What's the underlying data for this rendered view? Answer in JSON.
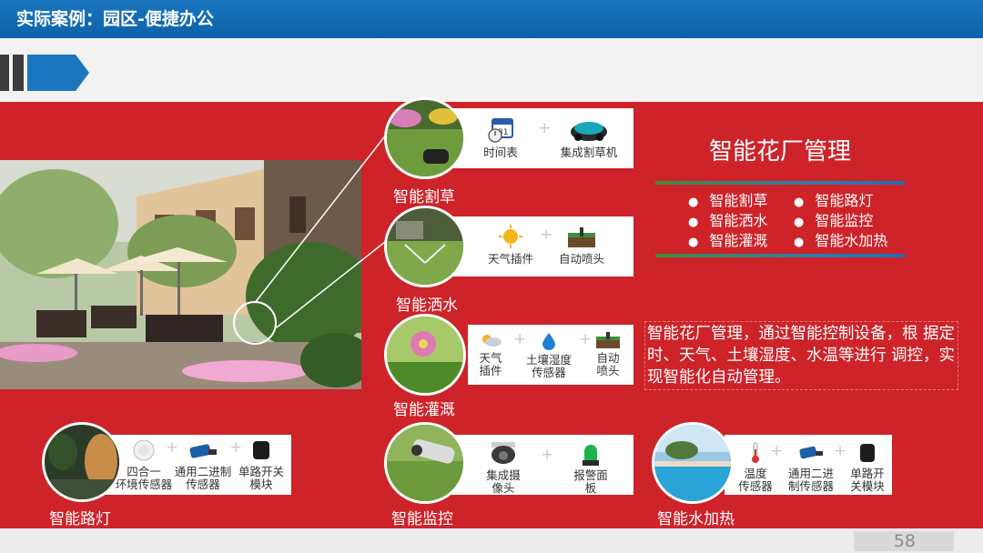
{
  "header": {
    "title": "实际案例：园区-便捷办公"
  },
  "page_number": "58",
  "main": {
    "heading": "智能花厂管理",
    "features": [
      {
        "label": "智能割草",
        "items": [
          "时间表",
          "集成割草机"
        ]
      },
      {
        "label": "智能洒水",
        "items": [
          "天气插件",
          "自动喷头"
        ]
      },
      {
        "label": "智能灌溉",
        "items": [
          "天气\n插件",
          "土壤湿度\n传感器",
          "自动\n喷头"
        ]
      },
      {
        "label": "智能路灯",
        "items": [
          "四合一\n环境传感器",
          "通用二进制\n传感器",
          "单路开关\n模块"
        ]
      },
      {
        "label": "智能监控",
        "items": [
          "集成摄\n像头",
          "报警面\n板"
        ]
      },
      {
        "label": "智能水加热",
        "items": [
          "温度\n传感器",
          "通用二进\n制传感器",
          "单路开\n关模块"
        ]
      }
    ],
    "bullets": [
      [
        "智能割草",
        "智能路灯"
      ],
      [
        "智能洒水",
        "智能监控"
      ],
      [
        "智能灌溉",
        "智能水加热"
      ]
    ],
    "description": "智能花厂管理，通过智能控制设备，根 据定时、天气、土壤湿度、水温等进行 调控，实现智能化自动管理。"
  },
  "icons": {
    "plus": "+",
    "names": [
      "calendar-clock-icon",
      "robot-mower-icon",
      "sun-icon",
      "sprinkler-icon",
      "weather-icon",
      "water-drop-icon",
      "sensor-icon",
      "usb-sensor-icon",
      "switch-module-icon",
      "camera-icon",
      "alarm-light-icon",
      "thermometer-icon"
    ]
  },
  "colors": {
    "header": "#1a76bf",
    "panel": "#cd2329",
    "accent_green": "#3f8c3f"
  }
}
